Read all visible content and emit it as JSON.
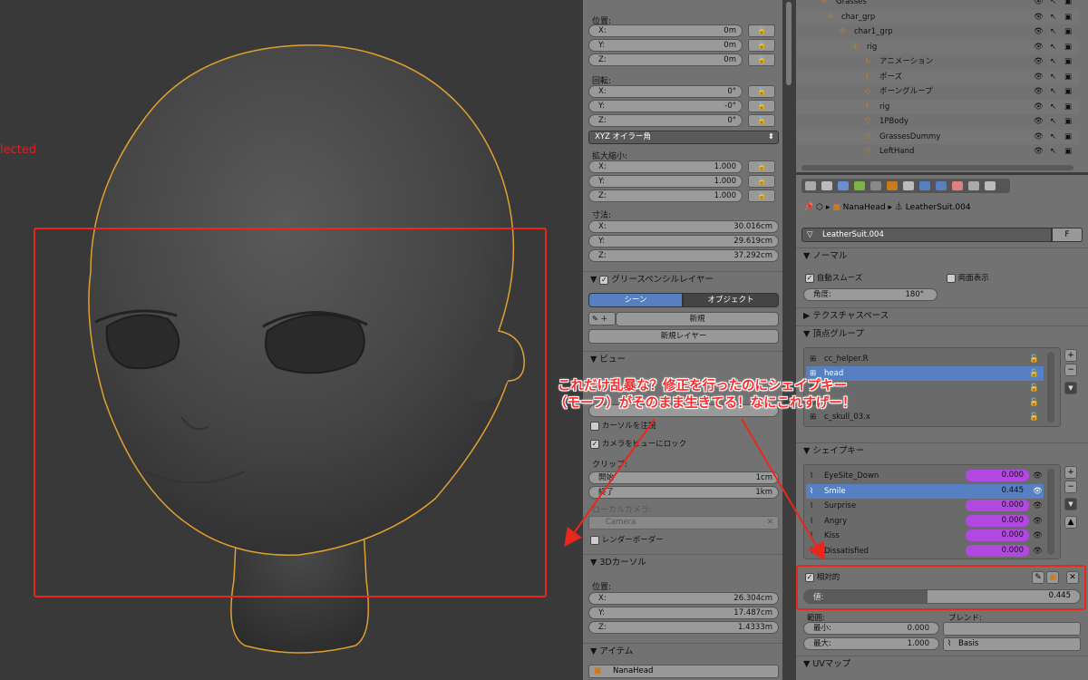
{
  "viewport": {
    "status_text": "elected"
  },
  "npanel": {
    "location_label": "位置:",
    "location": [
      {
        "axis": "X:",
        "value": "0m"
      },
      {
        "axis": "Y:",
        "value": "0m"
      },
      {
        "axis": "Z:",
        "value": "0m"
      }
    ],
    "rotation_label": "回転:",
    "rotation": [
      {
        "axis": "X:",
        "value": "0°"
      },
      {
        "axis": "Y:",
        "value": "-0°"
      },
      {
        "axis": "Z:",
        "value": "0°"
      }
    ],
    "rotation_mode": "XYZ オイラー角",
    "scale_label": "拡大縮小:",
    "scale": [
      {
        "axis": "X:",
        "value": "1.000"
      },
      {
        "axis": "Y:",
        "value": "1.000"
      },
      {
        "axis": "Z:",
        "value": "1.000"
      }
    ],
    "dimensions_label": "寸法:",
    "dimensions": [
      {
        "axis": "X:",
        "value": "30.016cm"
      },
      {
        "axis": "Y:",
        "value": "29.619cm"
      },
      {
        "axis": "Z:",
        "value": "37.292cm"
      }
    ],
    "grease_header": "グリースペンシルレイヤー",
    "scene_tab": "シーン",
    "object_tab": "オブジェクト",
    "new_btn": "新規",
    "new_layer_btn": "新規レイヤー",
    "view_header": "ビュー",
    "cursor_follow": "カーソルを注視",
    "lock_camera": "カメラをビューにロック",
    "clip_label": "クリップ:",
    "clip_start": "開始",
    "clip_start_val": "1cm",
    "clip_end": "終了",
    "clip_end_val": "1km",
    "local_camera": "ローカルカメラ:",
    "camera": "Camera",
    "render_border": "レンダーボーダー",
    "cursor_header": "3Dカーソル",
    "cursor_loc_label": "位置:",
    "cursor_loc": [
      {
        "axis": "X:",
        "value": "26.304cm"
      },
      {
        "axis": "Y:",
        "value": "17.487cm"
      },
      {
        "axis": "Z:",
        "value": "1.4333m"
      }
    ],
    "item_header": "アイテム",
    "item_name": "NanaHead"
  },
  "outliner": {
    "rows": [
      {
        "name": "Grasses"
      },
      {
        "name": "char_grp"
      },
      {
        "name": "char1_grp"
      },
      {
        "name": "rig"
      },
      {
        "name": "アニメーション"
      },
      {
        "name": "ポーズ"
      },
      {
        "name": "ボーングループ"
      },
      {
        "name": "rig"
      },
      {
        "name": "1PBody"
      },
      {
        "name": "GrassesDummy"
      },
      {
        "name": "LeftHand"
      }
    ]
  },
  "props": {
    "breadcrumb_obj": "NanaHead",
    "breadcrumb_mesh": "LeatherSuit.004",
    "mesh_name": "LeatherSuit.004",
    "fake_user": "F",
    "normals_header": "ノーマル",
    "auto_smooth": "自動スムーズ",
    "double_sided": "両面表示",
    "angle_label": "角度:",
    "angle_value": "180°",
    "texspace_header": "テクスチャスペース",
    "vgroups_header": "頂点グループ",
    "vgroups": [
      "cc_helper.R",
      "head",
      "",
      "",
      "c_skull_03.x"
    ],
    "shapekeys_header": "シェイプキー",
    "shapekeys": [
      {
        "name": "EyeSite_Down",
        "value": "0.000"
      },
      {
        "name": "Smile",
        "value": "0.445"
      },
      {
        "name": "Surprise",
        "value": "0.000"
      },
      {
        "name": "Angry",
        "value": "0.000"
      },
      {
        "name": "Kiss",
        "value": "0.000"
      },
      {
        "name": "Dissatisfied",
        "value": "0.000"
      }
    ],
    "relative": "相対的",
    "value_label": "値:",
    "value_num": "0.445",
    "value_fraction": 0.445,
    "range_label": "範囲:",
    "blend_label": "ブレンド:",
    "min_label": "最小:",
    "min_value": "0.000",
    "max_label": "最大:",
    "max_value": "1.000",
    "blend_value": "Basis",
    "uvmap_header": "UVマップ"
  },
  "annotation": {
    "line1": "これだけ乱暴な？修正を行ったのにシェイプキー",
    "line2": "（モーフ）がそのまま生きてる！なにこれすげー！"
  },
  "colors": {
    "annotation": "#ff2b2b",
    "selected": "#5680c2",
    "shape_value": "#b149e0",
    "outline": "#e0a030"
  }
}
